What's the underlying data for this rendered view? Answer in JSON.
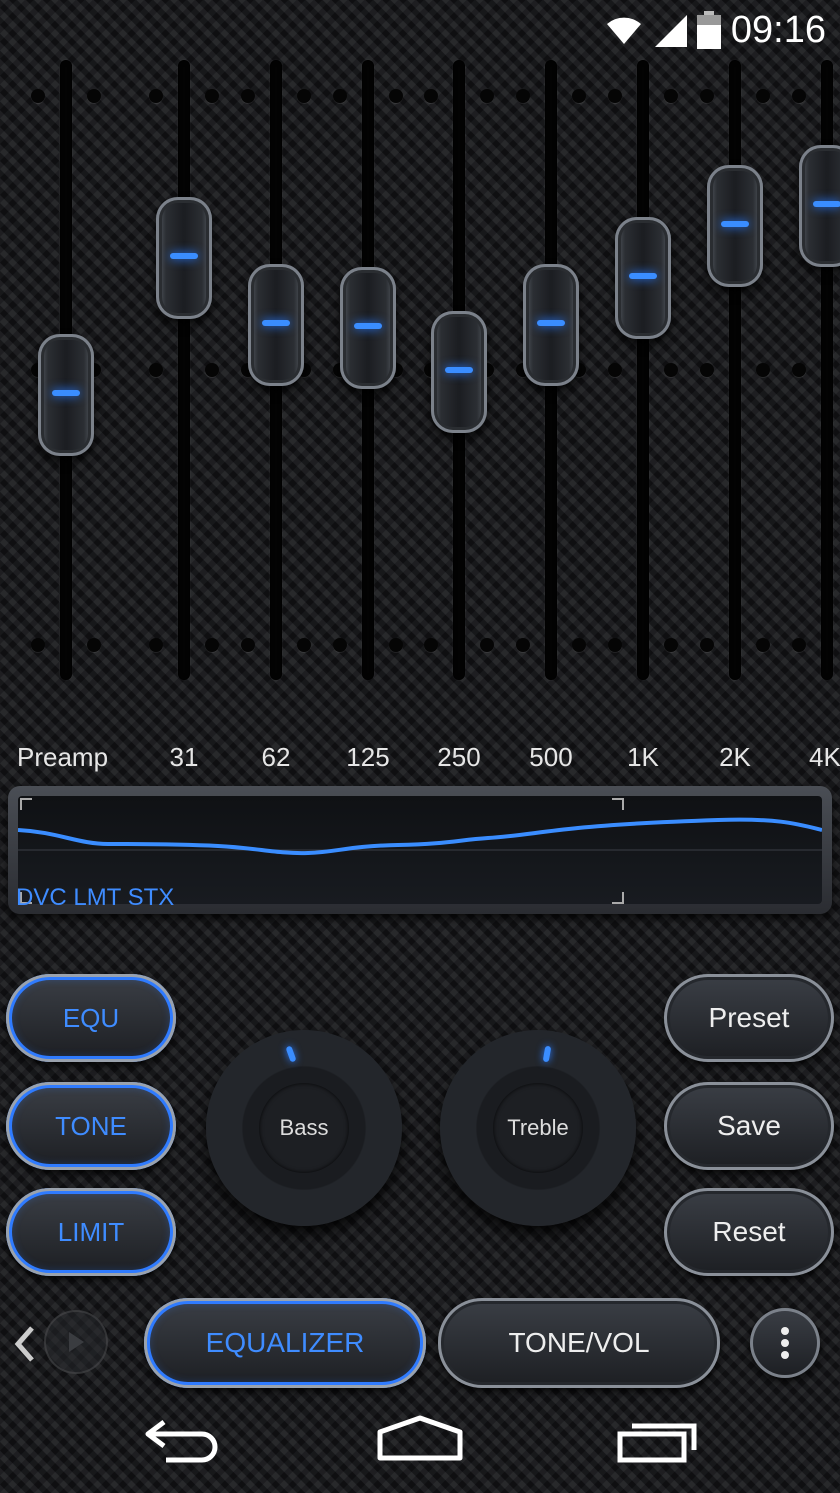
{
  "status_bar": {
    "time": "09:16",
    "icons": [
      "wifi-icon",
      "cell-signal-icon",
      "battery-icon"
    ]
  },
  "equalizer": {
    "bands": [
      {
        "label": "Preamp",
        "level": -0.1
      },
      {
        "label": "31",
        "level": 0.45
      },
      {
        "label": "62",
        "level": 0.18
      },
      {
        "label": "125",
        "level": 0.17
      },
      {
        "label": "250",
        "level": -0.01
      },
      {
        "label": "500",
        "level": 0.18
      },
      {
        "label": "1K",
        "level": 0.37
      },
      {
        "label": "2K",
        "level": 0.58
      },
      {
        "label": "4K",
        "level": 0.66
      }
    ]
  },
  "graph": {
    "label": "DVC LMT STX"
  },
  "left_buttons": {
    "equ": "EQU",
    "tone": "TONE",
    "limit": "LIMIT"
  },
  "dials": {
    "bass": "Bass",
    "treble": "Treble"
  },
  "right_buttons": {
    "preset": "Preset",
    "save": "Save",
    "reset": "Reset"
  },
  "tabs": {
    "equalizer": "EQUALIZER",
    "tone_vol": "TONE/VOL"
  },
  "colors": {
    "accent": "#3f8cff",
    "background": "#141518"
  }
}
